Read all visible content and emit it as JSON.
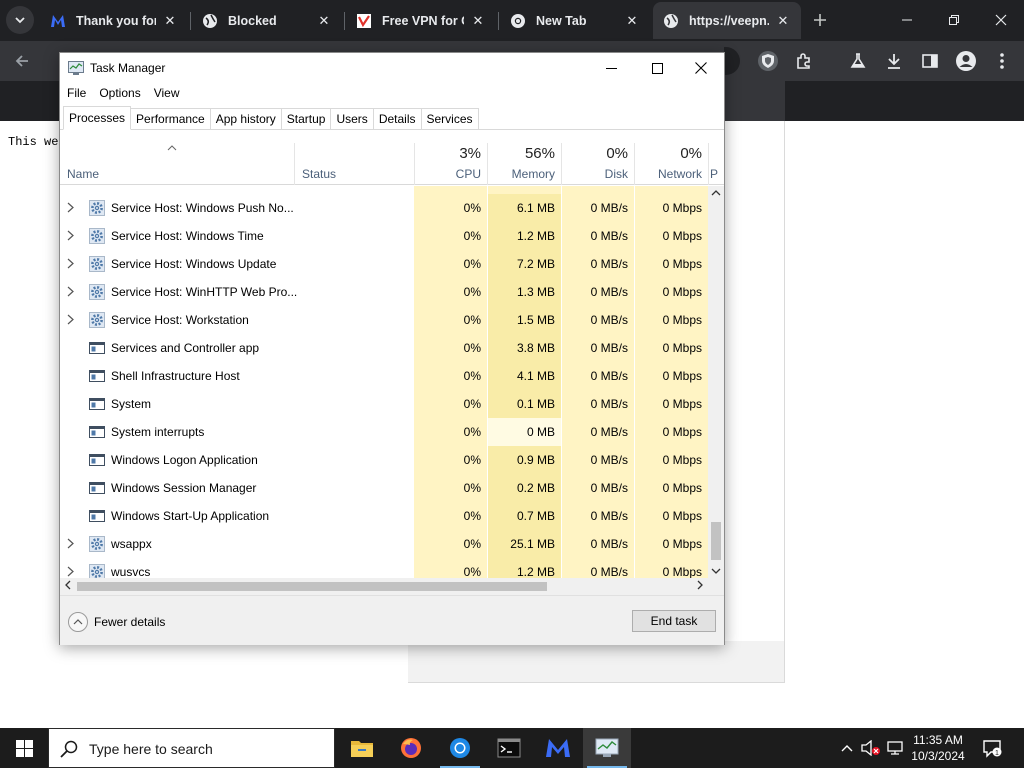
{
  "browser": {
    "tabs": [
      {
        "title": "Thank you for",
        "favicon": "malwarebytes-icon",
        "active": false
      },
      {
        "title": "Blocked",
        "favicon": "globe-icon",
        "active": false
      },
      {
        "title": "Free VPN for C",
        "favicon": "vpn-favicon",
        "active": false
      },
      {
        "title": "New Tab",
        "favicon": "chrome-icon",
        "active": false
      },
      {
        "title": "https://veepn.c",
        "favicon": "globe-icon",
        "active": true
      }
    ],
    "page_text": "This we"
  },
  "task_manager": {
    "title": "Task Manager",
    "menu": [
      "File",
      "Options",
      "View"
    ],
    "tabs": [
      "Processes",
      "Performance",
      "App history",
      "Startup",
      "Users",
      "Details",
      "Services"
    ],
    "active_tab": "Processes",
    "columns": {
      "name": "Name",
      "status": "Status",
      "cpu": {
        "percent": "3%",
        "label": "CPU"
      },
      "memory": {
        "percent": "56%",
        "label": "Memory"
      },
      "disk": {
        "percent": "0%",
        "label": "Disk"
      },
      "network": {
        "percent": "0%",
        "label": "Network"
      },
      "power": "P"
    },
    "processes": [
      {
        "name": "Service Host: Windows Push No...",
        "type": "service",
        "expandable": true,
        "cpu": "0%",
        "memory": "6.1 MB",
        "disk": "0 MB/s",
        "network": "0 Mbps"
      },
      {
        "name": "Service Host: Windows Time",
        "type": "service",
        "expandable": true,
        "cpu": "0%",
        "memory": "1.2 MB",
        "disk": "0 MB/s",
        "network": "0 Mbps"
      },
      {
        "name": "Service Host: Windows Update",
        "type": "service",
        "expandable": true,
        "cpu": "0%",
        "memory": "7.2 MB",
        "disk": "0 MB/s",
        "network": "0 Mbps"
      },
      {
        "name": "Service Host: WinHTTP Web Pro...",
        "type": "service",
        "expandable": true,
        "cpu": "0%",
        "memory": "1.3 MB",
        "disk": "0 MB/s",
        "network": "0 Mbps"
      },
      {
        "name": "Service Host: Workstation",
        "type": "service",
        "expandable": true,
        "cpu": "0%",
        "memory": "1.5 MB",
        "disk": "0 MB/s",
        "network": "0 Mbps"
      },
      {
        "name": "Services and Controller app",
        "type": "app",
        "expandable": false,
        "cpu": "0%",
        "memory": "3.8 MB",
        "disk": "0 MB/s",
        "network": "0 Mbps"
      },
      {
        "name": "Shell Infrastructure Host",
        "type": "app",
        "expandable": false,
        "cpu": "0%",
        "memory": "4.1 MB",
        "disk": "0 MB/s",
        "network": "0 Mbps"
      },
      {
        "name": "System",
        "type": "app",
        "expandable": false,
        "cpu": "0%",
        "memory": "0.1 MB",
        "disk": "0 MB/s",
        "network": "0 Mbps"
      },
      {
        "name": "System interrupts",
        "type": "app",
        "expandable": false,
        "cpu": "0%",
        "memory": "0 MB",
        "disk": "0 MB/s",
        "network": "0 Mbps"
      },
      {
        "name": "Windows Logon Application",
        "type": "app",
        "expandable": false,
        "cpu": "0%",
        "memory": "0.9 MB",
        "disk": "0 MB/s",
        "network": "0 Mbps"
      },
      {
        "name": "Windows Session Manager",
        "type": "app",
        "expandable": false,
        "cpu": "0%",
        "memory": "0.2 MB",
        "disk": "0 MB/s",
        "network": "0 Mbps"
      },
      {
        "name": "Windows Start-Up Application",
        "type": "app",
        "expandable": false,
        "cpu": "0%",
        "memory": "0.7 MB",
        "disk": "0 MB/s",
        "network": "0 Mbps"
      },
      {
        "name": "wsappx",
        "type": "service",
        "expandable": true,
        "cpu": "0%",
        "memory": "25.1 MB",
        "disk": "0 MB/s",
        "network": "0 Mbps"
      },
      {
        "name": "wusvcs",
        "type": "service",
        "expandable": true,
        "cpu": "0%",
        "memory": "1.2 MB",
        "disk": "0 MB/s",
        "network": "0 Mbps"
      }
    ],
    "footer": {
      "fewer_details": "Fewer details",
      "end_task": "End task"
    }
  },
  "taskbar": {
    "search_placeholder": "Type here to search",
    "apps": [
      "file-explorer-icon",
      "firefox-icon",
      "chrome-icon",
      "terminal-icon",
      "malwarebytes-icon",
      "task-manager-icon"
    ],
    "time": "11:35 AM",
    "date": "10/3/2024"
  },
  "colors": {
    "heat_light": "#fff4c4",
    "heat_medium": "#f9eca8",
    "chrome_dark": "#202124",
    "chrome_toolbar": "#35363a",
    "taskbar": "#1c1c1c"
  }
}
